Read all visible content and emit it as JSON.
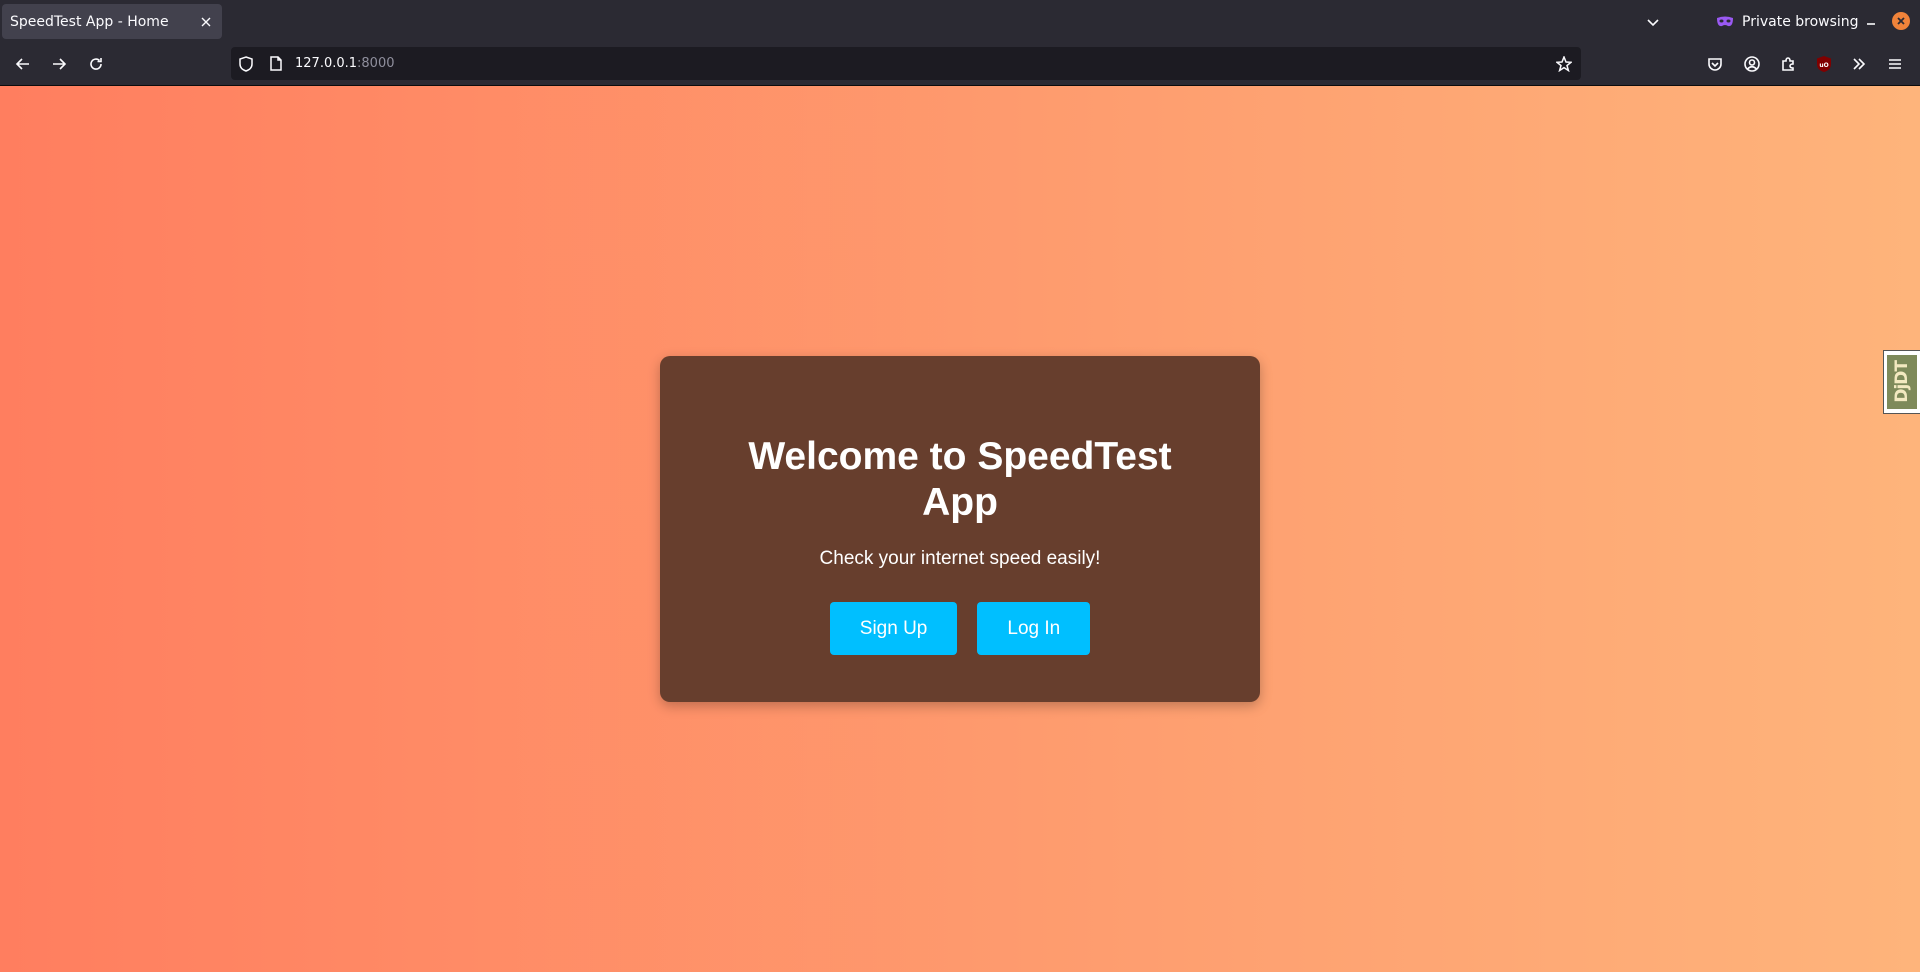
{
  "browser": {
    "tab_title": "SpeedTest App - Home",
    "private_label": "Private browsing",
    "url_host": "127.0.0.1",
    "url_port": ":8000",
    "ublock_badge": "uO"
  },
  "page": {
    "heading": "Welcome to SpeedTest App",
    "subtitle": "Check your internet speed easily!",
    "signup_label": "Sign Up",
    "login_label": "Log In",
    "toolbar_label": "DjDT"
  },
  "colors": {
    "gradient_start": "#ff7e5f",
    "gradient_end": "#feb47b",
    "card_bg": "#673e2d",
    "button_bg": "#00bfff"
  }
}
